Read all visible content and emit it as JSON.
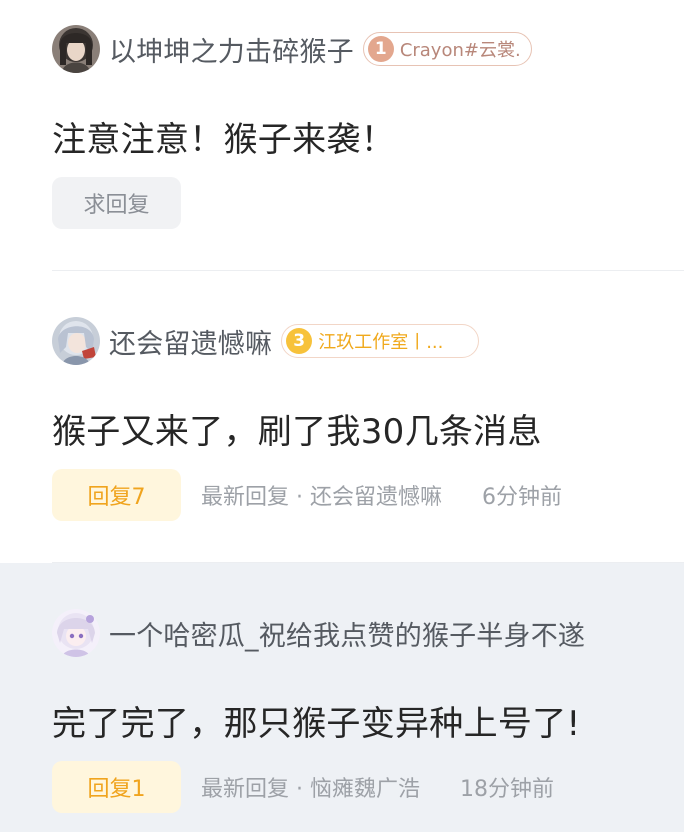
{
  "posts": [
    {
      "author": "以坤坤之力击碎猴子",
      "avatar_icon": "dark-haired-girl-avatar",
      "badge": {
        "level": "1",
        "text": "Crayon#云裳."
      },
      "content": "注意注意！猴子来袭！",
      "reply_label": "求回复"
    },
    {
      "author": "还会留遗憾嘛",
      "avatar_icon": "silver-haired-girl-avatar",
      "badge": {
        "level": "3",
        "text": "江玖工作室丨..."
      },
      "content": "猴子又来了，刷了我30几条消息",
      "reply_label": "回复7",
      "latest_reply": "最新回复 · 还会留遗憾嘛",
      "time": "6分钟前"
    },
    {
      "author": "一个哈密瓜_祝给我点赞的猴子半身不遂",
      "avatar_icon": "white-haired-anime-girl-avatar",
      "content": "完了完了，那只猴子变异种上号了!",
      "reply_label": "回复1",
      "latest_reply": "最新回复 · 恼瘫魏广浩",
      "time": "18分钟前"
    }
  ],
  "colors": {
    "accent_orange": "#f0a41e",
    "reply_bg_hot": "#fff6dd",
    "highlight_bg": "#eef1f5"
  }
}
